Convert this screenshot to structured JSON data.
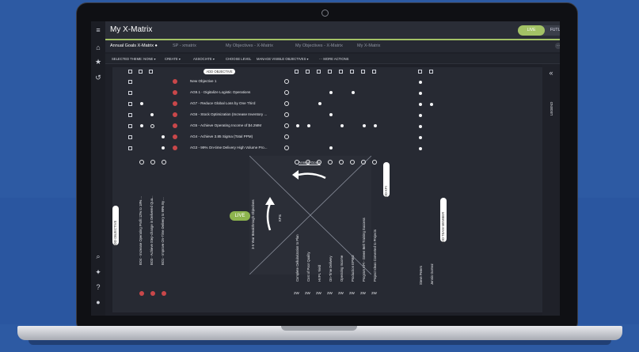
{
  "app": {
    "title": "My X-Matrix",
    "toggle_live": "LIVE",
    "toggle_future": "FUTURE"
  },
  "tabs": [
    {
      "label": "Annual Goals X-Matrix ●"
    },
    {
      "label": "SP - xmatrix"
    },
    {
      "label": "My Objectives - X-Matrix"
    },
    {
      "label": "My Objectives - X-Matrix"
    },
    {
      "label": "My X-Matrix"
    }
  ],
  "toolbar": {
    "theme": "SELECTED THEME: NONE ▾",
    "create": "CREATE ▾",
    "associate": "ASSOCIATE ▾",
    "choose_level": "CHOOSE LEVEL",
    "manage": "MANAGE VISIBLE OBJECTIVES ▾",
    "more": "⋯ MORE ACTIONS"
  },
  "matrix": {
    "add_objective": "ADD OBJECTIVE",
    "objectives": [
      "New Objective 1",
      "AG9.1 - Digitalize Logistic Operations",
      "AG7 - Reduce Global Loss by One Third",
      "AG6 - Stock Optimization (Increase Inventory ...",
      "AG5 - Achieve Operating Income of $4.2MM",
      "AG4 - Achieve 3.85 Sigma (Total PPM)",
      "AG3 - 99% On-time Delivery High Volume Pro..."
    ],
    "annual_goals": "Annual Goals",
    "live": "LIVE",
    "breakthrough": "3-5 Year Breakthrough Objectives",
    "add_objective_vertical": "ADD OBJECTIVE",
    "bo_items": [
      "BO4 - Increase Operating Profit 12% to 18% ...",
      "BO3 - Achieve Step-change in Delivered Qua...",
      "BO1 - Improve On-Time Delivery to 99% By ..."
    ],
    "kpis_label": "KPIs",
    "kpis": [
      "Complete Cellularization to Plan",
      "Cost of Poor Quality",
      "HVPL Yield",
      "On-Time Delivery",
      "Operating Income",
      "Production EPMO",
      "Program KPI - Green Belt Training Success",
      "Project Ideas Converted to Projects"
    ],
    "add_kpi": "ADD KPI",
    "team": [
      "Steve Peters",
      "Jennis Gomez"
    ],
    "add_team": "ADD TEAM MEMBER",
    "kpi_code": "2W"
  },
  "legend": "LEGEND"
}
